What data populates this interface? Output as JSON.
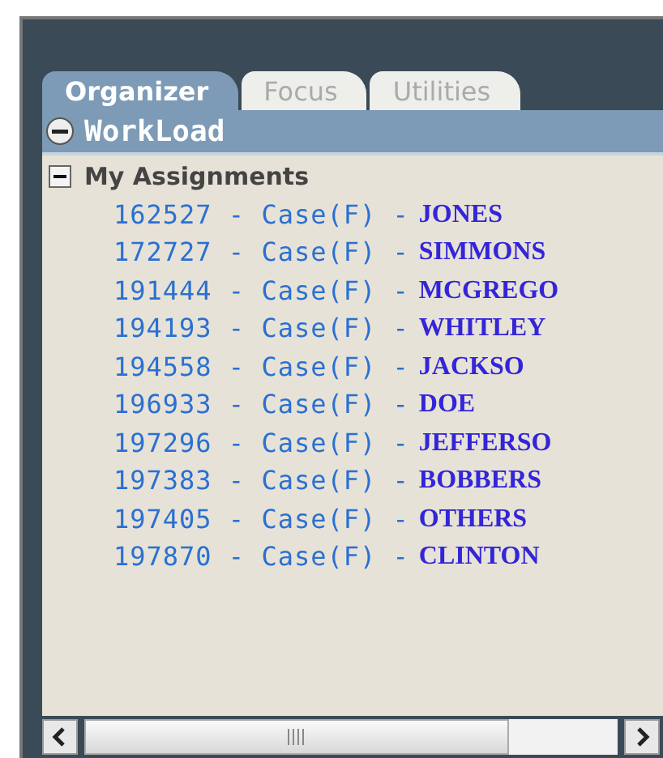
{
  "tabs": [
    {
      "label": "Organizer",
      "selected": true
    },
    {
      "label": "Focus",
      "selected": false
    },
    {
      "label": "Utilities",
      "selected": false
    }
  ],
  "section": {
    "title": "WorkLoad",
    "expanded": true
  },
  "group": {
    "title": "My Assignments",
    "expanded": true
  },
  "assignments": [
    {
      "case": "162527 - Case(F) -",
      "name": "JONES"
    },
    {
      "case": "172727 - Case(F) -",
      "name": "SIMMONS"
    },
    {
      "case": "191444 - Case(F) -",
      "name": "MCGREGO"
    },
    {
      "case": "194193 - Case(F) -",
      "name": "WHITLEY"
    },
    {
      "case": "194558 - Case(F) -",
      "name": "JACKSO"
    },
    {
      "case": "196933 - Case(F) -",
      "name": "DOE"
    },
    {
      "case": "197296 - Case(F) -",
      "name": "JEFFERSO"
    },
    {
      "case": "197383 - Case(F) -",
      "name": "BOBBERS"
    },
    {
      "case": "197405 - Case(F) -",
      "name": "OTHERS"
    },
    {
      "case": "197870 - Case(F) -",
      "name": "CLINTON"
    }
  ]
}
